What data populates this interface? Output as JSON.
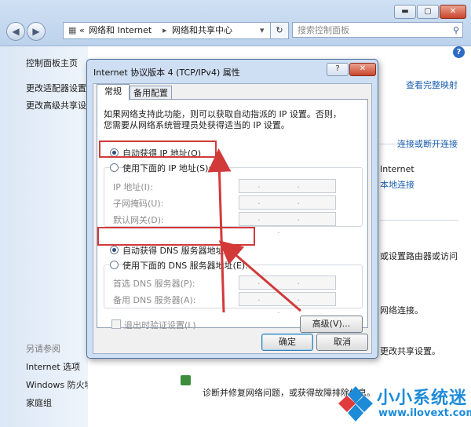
{
  "window": {
    "minimize": "▬",
    "maximize": "▢",
    "close": "✕",
    "back": "◀",
    "forward": "▶"
  },
  "address": {
    "prefix": "«",
    "crumb1": "网络和 Internet",
    "sep": "▸",
    "crumb2": "网络和共享中心",
    "dropdown": "▾",
    "refresh": "↻",
    "search_placeholder": "搜索控制面板",
    "search_icon": "⚲"
  },
  "leftpane": {
    "home": "控制面板主页",
    "adapter": "更改适配器设置",
    "advanced_sharing": "更改高级共享设置",
    "see_also": "另请参阅",
    "items": [
      "Internet 选项",
      "Windows 防火墙",
      "家庭组"
    ]
  },
  "mainpane": {
    "help": "?",
    "full_map": "查看完整映射",
    "connect_disconnect": "连接或断开连接",
    "internet": "Internet",
    "local_connection": "本地连接",
    "router_text": "或设置路由器或访问",
    "network_conn_text": "网络连接。",
    "sharing_text": "更改共享设置。",
    "troubleshoot_text": "诊断并修复网络问题，或获得故障排除信息。"
  },
  "dialog": {
    "title": "Internet 协议版本 4 (TCP/IPv4) 属性",
    "help": "?",
    "close": "✕",
    "tabs": [
      {
        "label": "常规"
      },
      {
        "label": "备用配置"
      }
    ],
    "intro": [
      "如果网络支持此功能，则可以获取自动指派的 IP 设置。否则，",
      "您需要从网络系统管理员处获得适当的 IP 设置。"
    ],
    "auto_ip": "自动获得 IP 地址(O)",
    "manual_ip": "使用下面的 IP 地址(S):",
    "ip_label": "IP 地址(I):",
    "mask_label": "子网掩码(U):",
    "gateway_label": "默认网关(D):",
    "auto_dns": "自动获得 DNS 服务器地址(B)",
    "manual_dns": "使用下面的 DNS 服务器地址(E):",
    "preferred_dns": "首选 DNS 服务器(P):",
    "alternate_dns": "备用 DNS 服务器(A):",
    "ip_placeholder": ". . .",
    "validate_on_exit": "退出时验证设置(L)",
    "advanced": "高级(V)...",
    "ok": "确定",
    "cancel": "取消"
  },
  "state": {
    "auto_ip_selected": true,
    "auto_dns_selected": true,
    "validate_checked": false
  },
  "watermark": {
    "title": "小小系统迷",
    "url": "www.ilovext.com"
  },
  "colors": {
    "highlight": "#d23a3a",
    "link": "#1c5fb0",
    "watermark": "#1d8bd8"
  }
}
